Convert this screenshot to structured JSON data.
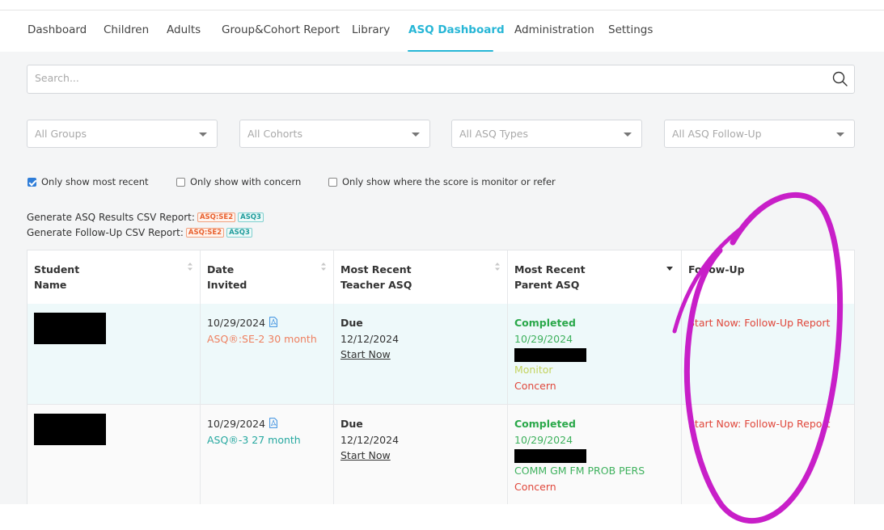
{
  "nav": {
    "items": [
      {
        "label": "Dashboard",
        "active": false
      },
      {
        "label": "Children",
        "active": false
      },
      {
        "label": "Adults",
        "active": false
      },
      {
        "label": "Group&Cohort Report",
        "active": false
      },
      {
        "label": "Library",
        "active": false
      },
      {
        "label": "ASQ Dashboard",
        "active": true
      },
      {
        "label": "Administration",
        "active": false
      },
      {
        "label": "Settings",
        "active": false
      }
    ]
  },
  "search": {
    "placeholder": "Search..."
  },
  "filters": [
    {
      "placeholder": "All Groups"
    },
    {
      "placeholder": "All Cohorts"
    },
    {
      "placeholder": "All ASQ Types"
    },
    {
      "placeholder": "All ASQ Follow-Up"
    }
  ],
  "checkboxes": [
    {
      "label": "Only show most recent",
      "checked": true
    },
    {
      "label": "Only show with concern",
      "checked": false
    },
    {
      "label": "Only show where the score is monitor or refer",
      "checked": false
    }
  ],
  "reports": {
    "results_label": "Generate ASQ Results CSV Report:",
    "followup_label": "Generate Follow-Up CSV Report:",
    "badge_se": "ASQ:SE2",
    "badge_3": "ASQ3"
  },
  "table": {
    "headers": {
      "student": [
        "Student",
        "Name"
      ],
      "date": [
        "Date",
        "Invited"
      ],
      "teacher": [
        "Most Recent",
        "Teacher ASQ"
      ],
      "parent": [
        "Most Recent",
        "Parent ASQ"
      ],
      "followup": "Follow-Up"
    },
    "rows": [
      {
        "date": "10/29/2024",
        "asq_type": "ASQ®:SE-2 30 month",
        "teacher_status": "Due",
        "teacher_date": "12/12/2024",
        "teacher_action": "Start Now",
        "parent_status": "Completed",
        "parent_date": "10/29/2024",
        "parent_score": "Monitor",
        "parent_concern": "Concern",
        "followup_action": "Start Now: Follow-Up Report"
      },
      {
        "date": "10/29/2024",
        "asq_type": "ASQ®-3 27 month",
        "teacher_status": "Due",
        "teacher_date": "12/12/2024",
        "teacher_action": "Start Now",
        "parent_status": "Completed",
        "parent_date": "10/29/2024",
        "parent_score": "COMM GM FM PROB PERS",
        "parent_concern": "Concern",
        "followup_action": "Start Now: Follow-Up Report"
      }
    ]
  },
  "colors": {
    "accent": "#27b6d6",
    "completed": "#2aa84a",
    "concern": "#e0473b",
    "annotation": "#c81fc8"
  }
}
